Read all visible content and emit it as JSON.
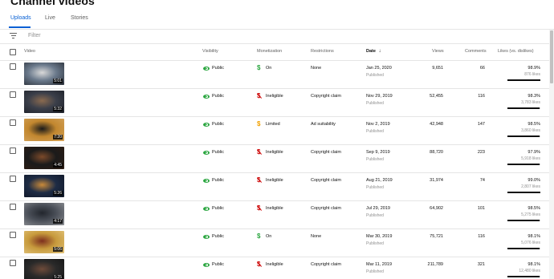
{
  "page": {
    "title": "Channel videos"
  },
  "tabs": [
    {
      "label": "Uploads",
      "active": true
    },
    {
      "label": "Live",
      "active": false
    },
    {
      "label": "Stories",
      "active": false
    }
  ],
  "filter": {
    "placeholder": "Filter",
    "icon": "filter-icon"
  },
  "columns": {
    "video": "Video",
    "visibility": "Visibility",
    "monetization": "Monetization",
    "restrictions": "Restrictions",
    "date": "Date",
    "date_sort_icon": "arrow-down-icon",
    "views": "Views",
    "comments": "Comments",
    "likes": "Likes (vs. dislikes)"
  },
  "colors": {
    "accent": "#065fd4",
    "public": "#2ba640",
    "on": "#2ba640",
    "ineligible": "#cc0000",
    "limited": "#f2a100"
  },
  "rows": [
    {
      "duration": "5:01",
      "visibility": "Public",
      "monetization": "On",
      "monetization_status": "on",
      "restrictions": "None",
      "date": "Jan 25, 2020",
      "date_status": "Published",
      "views": "9,651",
      "comments": "66",
      "likes_pct": "98.9%",
      "likes_count": "876 likes",
      "likes_ratio": 0.989,
      "thumb": [
        "#6b7a8c",
        "#d9d9d9",
        "#2a2f38"
      ]
    },
    {
      "duration": "5:32",
      "visibility": "Public",
      "monetization": "Ineligible",
      "monetization_status": "ineligible",
      "restrictions": "Copyright claim",
      "date": "Nov 29, 2019",
      "date_status": "Published",
      "views": "52,455",
      "comments": "116",
      "likes_pct": "98.3%",
      "likes_count": "3,783 likes",
      "likes_ratio": 0.983,
      "thumb": [
        "#3b3f4a",
        "#8a6a4f",
        "#1d2028"
      ]
    },
    {
      "duration": "7:20",
      "visibility": "Public",
      "monetization": "Limited",
      "monetization_status": "limited",
      "restrictions": "Ad suitability",
      "date": "Nov 2, 2019",
      "date_status": "Published",
      "views": "42,948",
      "comments": "147",
      "likes_pct": "98.5%",
      "likes_count": "3,860 likes",
      "likes_ratio": 0.985,
      "thumb": [
        "#c2872f",
        "#1a1a1a",
        "#d4a35a"
      ]
    },
    {
      "duration": "4:45",
      "visibility": "Public",
      "monetization": "Ineligible",
      "monetization_status": "ineligible",
      "restrictions": "Copyright claim",
      "date": "Sep 9, 2019",
      "date_status": "Published",
      "views": "88,720",
      "comments": "223",
      "likes_pct": "97.9%",
      "likes_count": "5,918 likes",
      "likes_ratio": 0.979,
      "thumb": [
        "#1b1b1b",
        "#7c4a2a",
        "#2e1c12"
      ]
    },
    {
      "duration": "5:26",
      "visibility": "Public",
      "monetization": "Ineligible",
      "monetization_status": "ineligible",
      "restrictions": "Copyright claim",
      "date": "Aug 21, 2019",
      "date_status": "Published",
      "views": "31,974",
      "comments": "74",
      "likes_pct": "99.0%",
      "likes_count": "2,807 likes",
      "likes_ratio": 0.99,
      "thumb": [
        "#1e2c45",
        "#c98a3a",
        "#0f1626"
      ]
    },
    {
      "duration": "4:17",
      "visibility": "Public",
      "monetization": "Ineligible",
      "monetization_status": "ineligible",
      "restrictions": "Copyright claim",
      "date": "Jul 29, 2019",
      "date_status": "Published",
      "views": "64,902",
      "comments": "101",
      "likes_pct": "98.5%",
      "likes_count": "5,275 likes",
      "likes_ratio": 0.985,
      "thumb": [
        "#4a4f58",
        "#22262d",
        "#8d8f93"
      ]
    },
    {
      "duration": "5:06",
      "visibility": "Public",
      "monetization": "On",
      "monetization_status": "on",
      "restrictions": "None",
      "date": "Mar 30, 2019",
      "date_status": "Published",
      "views": "75,721",
      "comments": "116",
      "likes_pct": "98.1%",
      "likes_count": "5,076 likes",
      "likes_ratio": 0.981,
      "thumb": [
        "#c79a3c",
        "#7d2f1e",
        "#e2c37a"
      ]
    },
    {
      "duration": "5:25",
      "visibility": "Public",
      "monetization": "Ineligible",
      "monetization_status": "ineligible",
      "restrictions": "Copyright claim",
      "date": "Mar 11, 2019",
      "date_status": "Published",
      "views": "211,789",
      "comments": "321",
      "likes_pct": "98.1%",
      "likes_count": "12,480 likes",
      "likes_ratio": 0.981,
      "thumb": [
        "#2a2a2a",
        "#6e4b3a",
        "#141414"
      ]
    }
  ]
}
